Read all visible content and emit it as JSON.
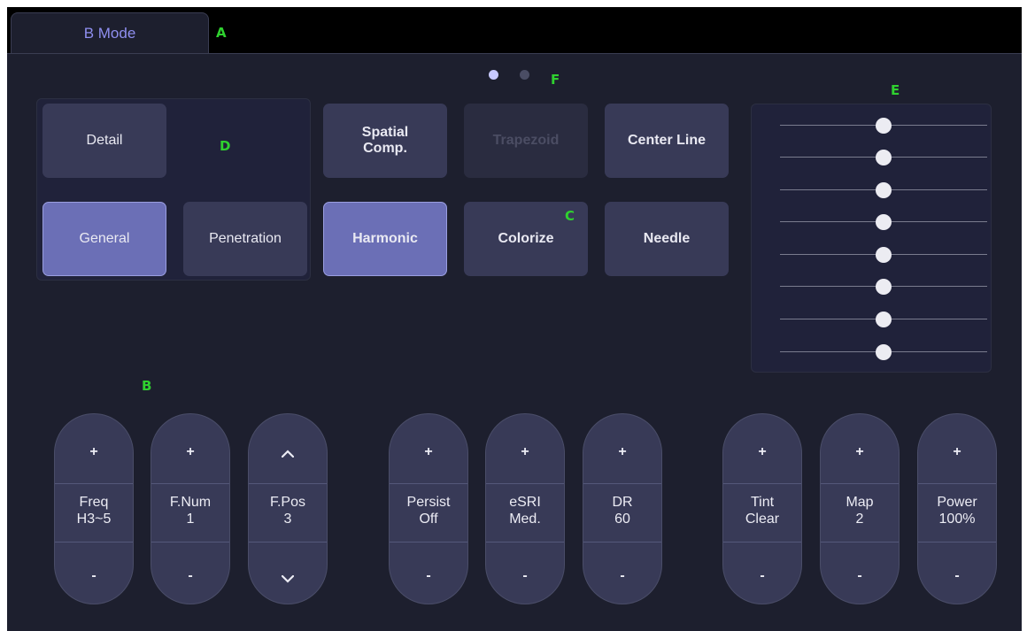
{
  "tab": {
    "label": "B Mode"
  },
  "markers": {
    "a": "A",
    "b": "B",
    "c": "C",
    "d": "D",
    "e": "E",
    "f": "F"
  },
  "pager": {
    "current": 1,
    "total": 2
  },
  "group_d": {
    "detail": "Detail",
    "general": "General",
    "penetration": "Penetration",
    "selected": "General"
  },
  "buttons": {
    "spatial": "Spatial\nComp.",
    "trapezoid": "Trapezoid",
    "center_line": "Center Line",
    "harmonic": "Harmonic",
    "colorize": "Colorize",
    "needle": "Needle"
  },
  "tgc_sliders": {
    "count": 8,
    "positions": [
      0.5,
      0.5,
      0.5,
      0.5,
      0.5,
      0.5,
      0.5,
      0.5
    ]
  },
  "controls": [
    {
      "name": "Freq",
      "value": "H3~5",
      "up": "+",
      "down": "-"
    },
    {
      "name": "F.Num",
      "value": "1",
      "up": "+",
      "down": "-"
    },
    {
      "name": "F.Pos",
      "value": "3",
      "up": "chevron-up",
      "down": "chevron-down"
    },
    {
      "name": "Persist",
      "value": "Off",
      "up": "+",
      "down": "-"
    },
    {
      "name": "eSRI",
      "value": "Med.",
      "up": "+",
      "down": "-"
    },
    {
      "name": "DR",
      "value": "60",
      "up": "+",
      "down": "-"
    },
    {
      "name": "Tint",
      "value": "Clear",
      "up": "+",
      "down": "-"
    },
    {
      "name": "Map",
      "value": "2",
      "up": "+",
      "down": "-"
    },
    {
      "name": "Power",
      "value": "100%",
      "up": "+",
      "down": "-"
    }
  ],
  "colors": {
    "background": "#1d1f2e",
    "button": "#383a57",
    "selected": "#6b6fb6",
    "tab_text": "#8f8ff0",
    "marker": "#2fd12f"
  }
}
